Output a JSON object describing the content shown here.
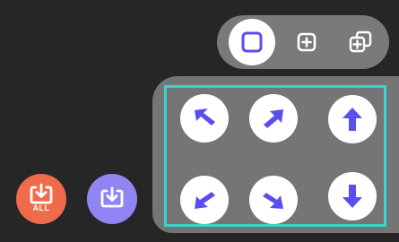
{
  "colors": {
    "background": "#262626",
    "toolbar": "#7a7a7a",
    "panel": "#757575",
    "highlight_border": "#38d4d0",
    "accent": "#5b4ef0",
    "download_all_button": "#f06a4c",
    "download_button": "#8f86f3"
  },
  "mode_toolbar": {
    "buttons": [
      {
        "icon": "square-outline-icon",
        "active": true
      },
      {
        "icon": "plus-square-icon",
        "active": false
      },
      {
        "icon": "duplicate-plus-icon",
        "active": false
      }
    ]
  },
  "direction_pad": {
    "buttons": [
      {
        "icon": "arrow-up-left-icon"
      },
      {
        "icon": "arrow-up-right-icon"
      },
      {
        "icon": "arrow-up-icon"
      },
      {
        "icon": "arrow-down-left-icon"
      },
      {
        "icon": "arrow-down-right-icon"
      },
      {
        "icon": "arrow-down-icon"
      }
    ]
  },
  "bottom_actions": {
    "download_all_label": "ALL"
  }
}
